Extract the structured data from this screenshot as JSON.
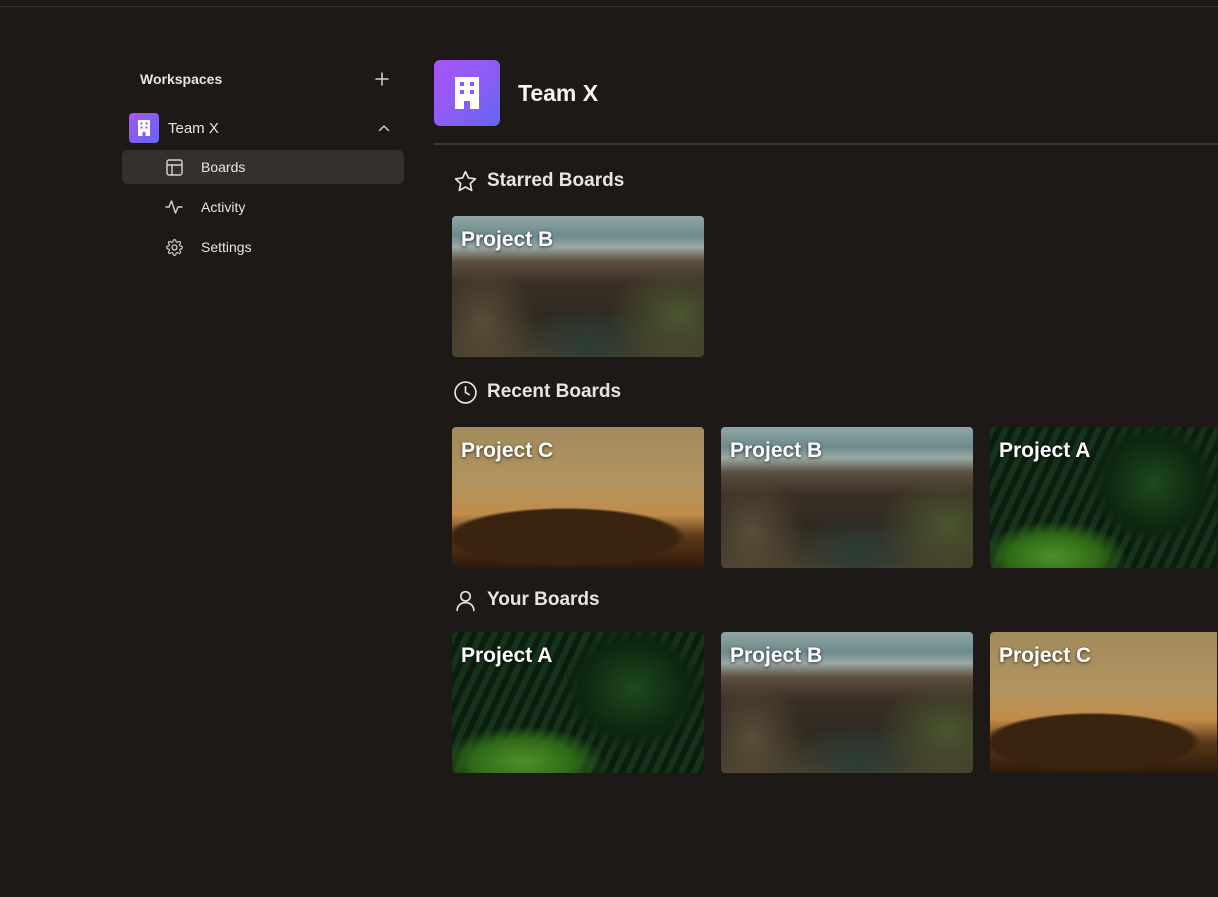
{
  "sidebar": {
    "workspaces_label": "Workspaces",
    "team": {
      "name": "Team X"
    },
    "nav": [
      {
        "label": "Boards",
        "icon": "layout-icon",
        "active": true
      },
      {
        "label": "Activity",
        "icon": "activity-icon",
        "active": false
      },
      {
        "label": "Settings",
        "icon": "gear-icon",
        "active": false
      }
    ]
  },
  "main": {
    "title": "Team X",
    "sections": [
      {
        "label": "Starred Boards",
        "icon": "star-icon",
        "boards": [
          {
            "title": "Project B",
            "image": "mountain"
          }
        ]
      },
      {
        "label": "Recent Boards",
        "icon": "clock-icon",
        "boards": [
          {
            "title": "Project C",
            "image": "desert"
          },
          {
            "title": "Project B",
            "image": "mountain"
          },
          {
            "title": "Project A",
            "image": "leaf"
          }
        ]
      },
      {
        "label": "Your Boards",
        "icon": "user-icon",
        "boards": [
          {
            "title": "Project A",
            "image": "leaf"
          },
          {
            "title": "Project B",
            "image": "mountain"
          },
          {
            "title": "Project C",
            "image": "desert"
          }
        ]
      }
    ]
  },
  "colors": {
    "background": "#1c1917",
    "active_nav": "#36302d",
    "accent_gradient_start": "#a855f7",
    "accent_gradient_end": "#6366f1"
  }
}
